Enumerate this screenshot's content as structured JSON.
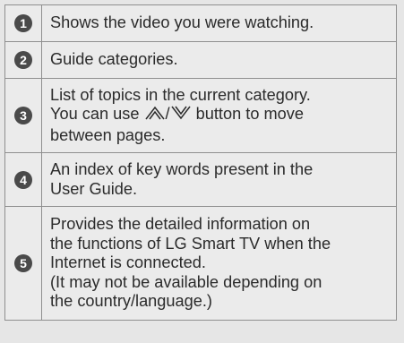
{
  "rows": [
    {
      "number": "1",
      "lines": [
        "Shows the video you were watching."
      ]
    },
    {
      "number": "2",
      "lines": [
        "Guide categories."
      ]
    },
    {
      "number": "3",
      "lines": [
        "List of topics in the current category."
      ],
      "line2_before": "You can use",
      "line2_separator": "/",
      "line2_after": "button to move",
      "up_icon": "double-chevron-up-icon",
      "down_icon": "double-chevron-down-icon",
      "line3": "between pages."
    },
    {
      "number": "4",
      "lines": [
        "An index of key words present in the",
        "User Guide."
      ]
    },
    {
      "number": "5",
      "lines": [
        "Provides the detailed information on",
        "the functions of LG Smart TV when the",
        "Internet is connected.",
        "(It may not be available depending on",
        "the country/language.)"
      ]
    }
  ]
}
